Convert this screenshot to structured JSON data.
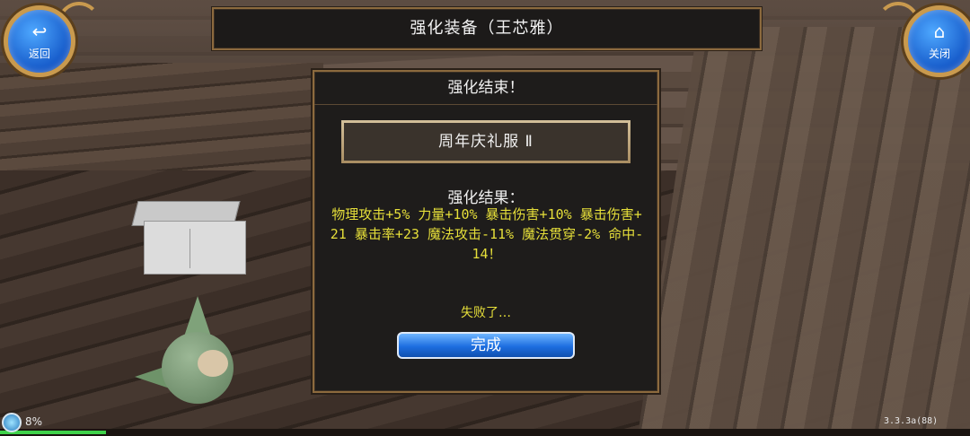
{
  "window": {
    "title": "强化装备（王芯雅）"
  },
  "buttons": {
    "back": {
      "icon": "return-arrow-icon",
      "label": "返回"
    },
    "close": {
      "icon": "home-icon",
      "label": "关闭"
    }
  },
  "dialog": {
    "header": "强化结束！",
    "item_name": "周年庆礼服 Ⅱ",
    "result_title": "强化结果：",
    "result_text": "物理攻击+5% 力量+10% 暴击伤害+10% 暴击伤害+21 暴击率+23 魔法攻击-11% 魔法贯穿-2% 命中-14！",
    "status": "失败了…",
    "confirm_label": "完成"
  },
  "footer": {
    "exp_percent": "8%",
    "version": "3.3.3a(88)"
  },
  "colors": {
    "frame_gold": "#8c6a3e",
    "result_yellow": "#e6df3a",
    "button_blue": "#1d6ee0"
  }
}
